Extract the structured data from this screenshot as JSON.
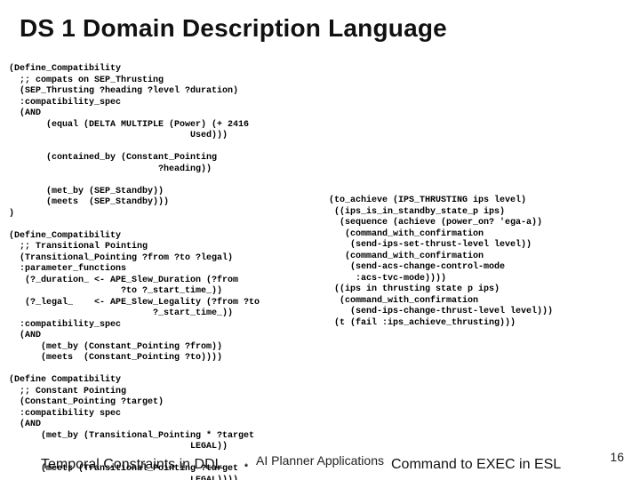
{
  "title": "DS 1 Domain Description Language",
  "code_left": "(Define_Compatibility\n  ;; compats on SEP_Thrusting\n  (SEP_Thrusting ?heading ?level ?duration)\n  :compatibility_spec\n  (AND\n       (equal (DELTA MULTIPLE (Power) (+ 2416\n                                  Used)))\n\n       (contained_by (Constant_Pointing\n                            ?heading))\n\n       (met_by (SEP_Standby))\n       (meets  (SEP_Standby)))\n)\n\n(Define_Compatibility\n  ;; Transitional Pointing\n  (Transitional_Pointing ?from ?to ?legal)\n  :parameter_functions\n   (?_duration_ <- APE_Slew_Duration (?from\n                     ?to ?_start_time_))\n   (?_legal_    <- APE_Slew_Legality (?from ?to\n                           ?_start_time_))\n  :compatibility_spec\n  (AND\n      (met_by (Constant_Pointing ?from))\n      (meets  (Constant_Pointing ?to))))\n\n(Define Compatibility\n  ;; Constant Pointing\n  (Constant_Pointing ?target)\n  :compatibility spec\n  (AND\n      (met_by (Transitional_Pointing * ?target\n                                  LEGAL))\n\n      (meets (Transitional_Pointing ?target *\n                                  LEGAL))))",
  "code_right": "(to_achieve (IPS_THRUSTING ips level)\n ((ips_is_in_standby_state_p ips)\n  (sequence (achieve (power_on? 'ega-a))\n   (command_with_confirmation\n    (send-ips-set-thrust-level level))\n   (command_with_confirmation\n    (send-acs-change-control-mode\n     :acs-tvc-mode))))\n ((ips in thrusting state p ips)\n  (command_with_confirmation\n    (send-ips-change-thrust-level level)))\n (t (fail :ips_achieve_thrusting)))",
  "footer": {
    "center": "AI Planner Applications",
    "left": "Temporal Constraints in DDL",
    "right": "Command to EXEC in ESL",
    "page": "16"
  }
}
